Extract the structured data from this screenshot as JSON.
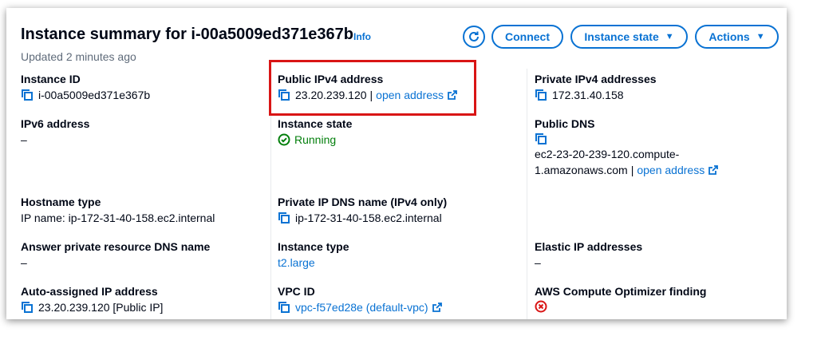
{
  "header": {
    "title": "Instance summary for i-00a5009ed371e367b",
    "info_link": "Info",
    "updated": "Updated 2 minutes ago",
    "connect_label": "Connect",
    "instance_state_label": "Instance state",
    "actions_label": "Actions"
  },
  "col1": {
    "instance_id_label": "Instance ID",
    "instance_id_value": "i-00a5009ed371e367b",
    "ipv6_label": "IPv6 address",
    "ipv6_value": "–",
    "hostname_type_label": "Hostname type",
    "hostname_type_value": "IP name: ip-172-31-40-158.ec2.internal",
    "answer_dns_label": "Answer private resource DNS name",
    "answer_dns_value": "–",
    "auto_ip_label": "Auto-assigned IP address",
    "auto_ip_value": "23.20.239.120 [Public IP]"
  },
  "col2": {
    "public_ipv4_label": "Public IPv4 address",
    "public_ipv4_value": "23.20.239.120",
    "separator": "|",
    "open_address": "open address",
    "instance_state_label": "Instance state",
    "instance_state_value": "Running",
    "private_dns_label": "Private IP DNS name (IPv4 only)",
    "private_dns_value": "ip-172-31-40-158.ec2.internal",
    "instance_type_label": "Instance type",
    "instance_type_value": "t2.large",
    "vpc_label": "VPC ID",
    "vpc_value": "vpc-f57ed28e (default-vpc)"
  },
  "col3": {
    "private_ipv4_label": "Private IPv4 addresses",
    "private_ipv4_value": "172.31.40.158",
    "public_dns_label": "Public DNS",
    "public_dns_line1": "ec2-23-20-239-120.compute-",
    "public_dns_line2": "1.amazonaws.com",
    "separator": "|",
    "open_address": "open address",
    "elastic_ip_label": "Elastic IP addresses",
    "elastic_ip_value": "–",
    "optimizer_label": "AWS Compute Optimizer finding"
  },
  "colors": {
    "link": "#0972d3",
    "success": "#037f0c",
    "error": "#d91515",
    "highlight_border": "#d91515"
  }
}
